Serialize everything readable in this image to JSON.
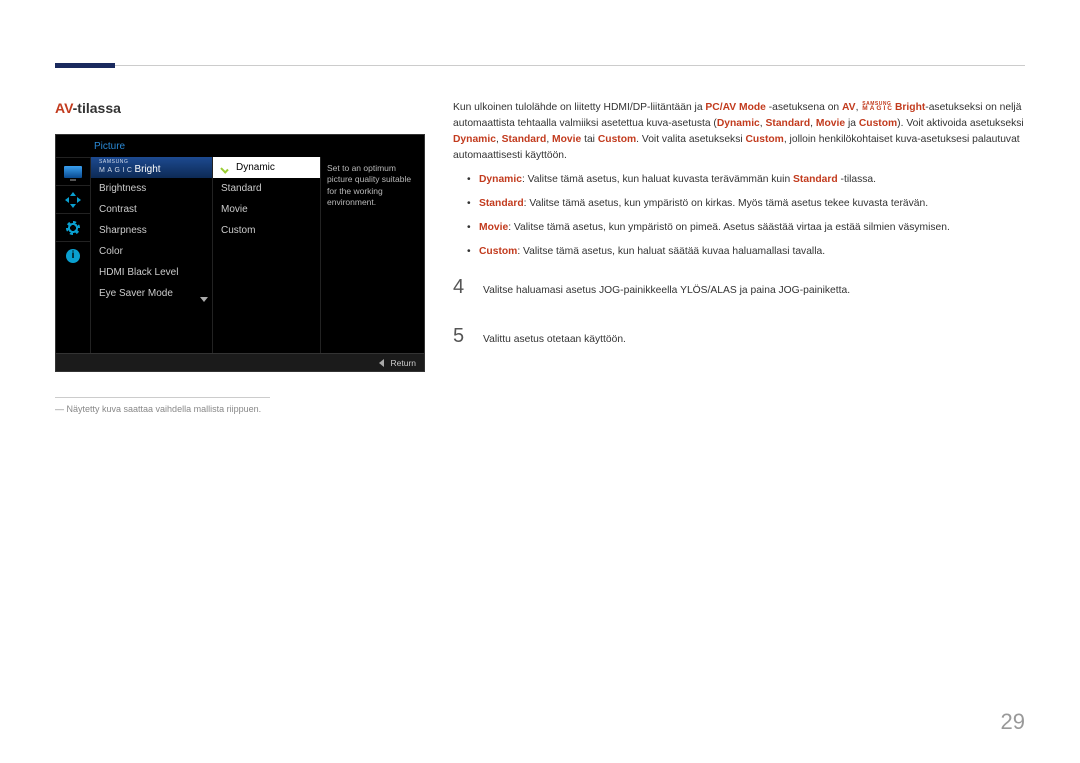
{
  "title": {
    "av": "AV",
    "suffix": "-tilassa"
  },
  "osd": {
    "category": "Picture",
    "magicBright": {
      "samsung": "SAMSUNG",
      "magic": "MAGIC",
      "bright": "Bright"
    },
    "items": [
      "Brightness",
      "Contrast",
      "Sharpness",
      "Color",
      "HDMI Black Level",
      "Eye Saver Mode"
    ],
    "options": [
      "Dynamic",
      "Standard",
      "Movie",
      "Custom"
    ],
    "description": "Set to an optimum picture quality suitable for the working environment.",
    "return": "Return",
    "infoChar": "i"
  },
  "disclaimer": "― Näytetty kuva saattaa vaihdella mallista riippuen.",
  "intro": {
    "t1": "Kun ulkoinen tulolähde on liitetty HDMI/DP-liitäntään ja ",
    "t2": "PC/AV Mode",
    "t3": " -asetuksena on ",
    "t4": "AV",
    "t5": ", ",
    "t6": "Bright",
    "t7": "-asetukseksi on neljä automaattista tehtaalla valmiiksi asetettua kuva-asetusta (",
    "t8": "Dynamic",
    "t9": ", ",
    "t10": "Standard",
    "t11": ", ",
    "t12": "Movie",
    "t13": " ja ",
    "t14": "Custom",
    "t15": "). Voit aktivoida asetukseksi ",
    "t16": "Dynamic",
    "t17": ", ",
    "t18": "Standard",
    "t19": ", ",
    "t20": "Movie",
    "t21": " tai ",
    "t22": "Custom",
    "t23": ". Voit valita asetukseksi ",
    "t24": "Custom",
    "t25": ", jolloin henkilökohtaiset kuva-asetuksesi palautuvat automaattisesti käyttöön."
  },
  "bullets": {
    "b1a": "Dynamic",
    "b1b": ": Valitse tämä asetus, kun haluat kuvasta terävämmän kuin ",
    "b1c": "Standard",
    "b1d": " -tilassa.",
    "b2a": "Standard",
    "b2b": ": Valitse tämä asetus, kun ympäristö on kirkas. Myös tämä asetus tekee kuvasta terävän.",
    "b3a": "Movie",
    "b3b": ": Valitse tämä asetus, kun ympäristö on pimeä. Asetus säästää virtaa ja estää silmien väsymisen.",
    "b4a": "Custom",
    "b4b": ": Valitse tämä asetus, kun haluat säätää kuvaa haluamallasi tavalla."
  },
  "steps": {
    "n4": "4",
    "s4": "Valitse haluamasi asetus JOG-painikkeella YLÖS/ALAS ja paina JOG-painiketta.",
    "n5": "5",
    "s5": "Valittu asetus otetaan käyttöön."
  },
  "magicInline": {
    "top": "SAMSUNG",
    "bot": "MAGIC"
  },
  "pageNumber": "29"
}
